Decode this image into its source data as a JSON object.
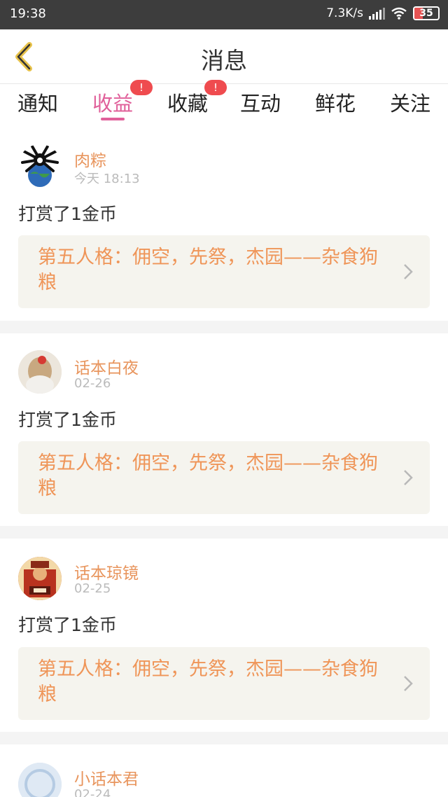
{
  "status_bar": {
    "time": "19:38",
    "network_speed": "7.3K/s",
    "battery": "35",
    "battery_level": 0.35
  },
  "header": {
    "title": "消息",
    "back_icon": "chevron-left-icon"
  },
  "tabs": [
    {
      "label": "通知",
      "badge": ""
    },
    {
      "label": "收益",
      "badge": "!",
      "active": true
    },
    {
      "label": "收藏",
      "badge": "!"
    },
    {
      "label": "互动",
      "badge": ""
    },
    {
      "label": "鲜花",
      "badge": ""
    },
    {
      "label": "关注",
      "badge": ""
    }
  ],
  "colors": {
    "accent": "#e0609a",
    "badge": "#ef4b4f",
    "username": "#e8955d",
    "quote_text": "#ef9558",
    "quote_bg": "#f5f4ee"
  },
  "messages": [
    {
      "username": "肉粽",
      "time": "今天 18:13",
      "action": "打赏了1金币",
      "work_title": "第五人格：佣空，先祭，杰园——杂食狗粮"
    },
    {
      "username": "话本白夜",
      "time": "02-26",
      "action": "打赏了1金币",
      "work_title": "第五人格：佣空，先祭，杰园——杂食狗粮"
    },
    {
      "username": "话本琼镜",
      "time": "02-25",
      "action": "打赏了1金币",
      "work_title": "第五人格：佣空，先祭，杰园——杂食狗粮"
    },
    {
      "username": "小话本君",
      "time": "02-24"
    }
  ]
}
